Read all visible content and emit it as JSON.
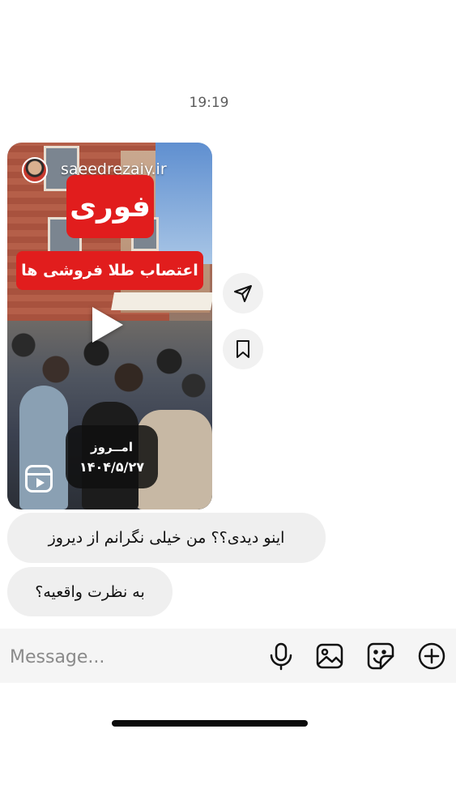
{
  "timestamp": "19:19",
  "reel": {
    "username": "saeedrezaiy.ir",
    "badge": "فوری",
    "headline": "اعتصاب طلا فروشی ها",
    "date_line1": "امــروز",
    "date_line2": "۱۴۰۴/۵/۲۷"
  },
  "messages": [
    {
      "text": "اینو دیدی؟؟ من خیلی نگرانم از دیروز"
    },
    {
      "text": "به نظرت واقعیه؟"
    }
  ],
  "composer": {
    "placeholder": "Message..."
  },
  "icons": {
    "share": "paper-plane-icon",
    "save": "bookmark-icon",
    "mic": "microphone-icon",
    "gallery": "image-icon",
    "sticker": "sticker-icon",
    "add": "plus-circle-icon"
  }
}
